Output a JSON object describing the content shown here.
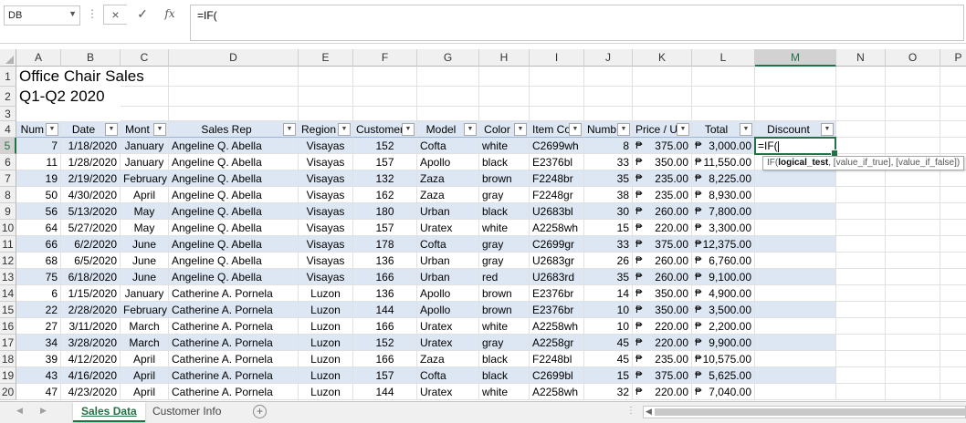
{
  "formula_bar": {
    "name_box": "DB",
    "formula": "=IF("
  },
  "icons": {
    "cancel": "×",
    "enter": "✓",
    "fx": "fx"
  },
  "columns": [
    "A",
    "B",
    "C",
    "D",
    "E",
    "F",
    "G",
    "H",
    "I",
    "J",
    "K",
    "L",
    "M",
    "N",
    "O",
    "P"
  ],
  "selected_column": "M",
  "rows": [
    "1",
    "2",
    "3",
    "4",
    "5",
    "6",
    "7",
    "8",
    "9",
    "10",
    "11",
    "12",
    "13",
    "14",
    "15",
    "16",
    "17",
    "18",
    "19",
    "20"
  ],
  "selected_row": "5",
  "sheet_title": "Office Chair Sales",
  "sheet_subtitle": "Q1-Q2 2020",
  "table_headers": [
    "Num",
    "Date",
    "Mont",
    "Sales Rep",
    "Region",
    "Customer",
    "Model",
    "Color",
    "Item Co",
    "Numb",
    "Price / Un",
    "Total",
    "Discount"
  ],
  "currency_symbol": "₱",
  "table_rows": [
    [
      "7",
      "1/18/2020",
      "January",
      "Angeline Q. Abella",
      "Visayas",
      "152",
      "Cofta",
      "white",
      "C2699wh",
      "8",
      "375.00",
      "3,000.00"
    ],
    [
      "11",
      "1/28/2020",
      "January",
      "Angeline Q. Abella",
      "Visayas",
      "157",
      "Apollo",
      "black",
      "E2376bl",
      "33",
      "350.00",
      "11,550.00"
    ],
    [
      "19",
      "2/19/2020",
      "February",
      "Angeline Q. Abella",
      "Visayas",
      "132",
      "Zaza",
      "brown",
      "F2248br",
      "35",
      "235.00",
      "8,225.00"
    ],
    [
      "50",
      "4/30/2020",
      "April",
      "Angeline Q. Abella",
      "Visayas",
      "162",
      "Zaza",
      "gray",
      "F2248gr",
      "38",
      "235.00",
      "8,930.00"
    ],
    [
      "56",
      "5/13/2020",
      "May",
      "Angeline Q. Abella",
      "Visayas",
      "180",
      "Urban",
      "black",
      "U2683bl",
      "30",
      "260.00",
      "7,800.00"
    ],
    [
      "64",
      "5/27/2020",
      "May",
      "Angeline Q. Abella",
      "Visayas",
      "157",
      "Uratex",
      "white",
      "A2258wh",
      "15",
      "220.00",
      "3,300.00"
    ],
    [
      "66",
      "6/2/2020",
      "June",
      "Angeline Q. Abella",
      "Visayas",
      "178",
      "Cofta",
      "gray",
      "C2699gr",
      "33",
      "375.00",
      "12,375.00"
    ],
    [
      "68",
      "6/5/2020",
      "June",
      "Angeline Q. Abella",
      "Visayas",
      "136",
      "Urban",
      "gray",
      "U2683gr",
      "26",
      "260.00",
      "6,760.00"
    ],
    [
      "75",
      "6/18/2020",
      "June",
      "Angeline Q. Abella",
      "Visayas",
      "166",
      "Urban",
      "red",
      "U2683rd",
      "35",
      "260.00",
      "9,100.00"
    ],
    [
      "6",
      "1/15/2020",
      "January",
      "Catherine A. Pornela",
      "Luzon",
      "136",
      "Apollo",
      "brown",
      "E2376br",
      "14",
      "350.00",
      "4,900.00"
    ],
    [
      "22",
      "2/28/2020",
      "February",
      "Catherine A. Pornela",
      "Luzon",
      "144",
      "Apollo",
      "brown",
      "E2376br",
      "10",
      "350.00",
      "3,500.00"
    ],
    [
      "27",
      "3/11/2020",
      "March",
      "Catherine A. Pornela",
      "Luzon",
      "166",
      "Uratex",
      "white",
      "A2258wh",
      "10",
      "220.00",
      "2,200.00"
    ],
    [
      "34",
      "3/28/2020",
      "March",
      "Catherine A. Pornela",
      "Luzon",
      "152",
      "Uratex",
      "gray",
      "A2258gr",
      "45",
      "220.00",
      "9,900.00"
    ],
    [
      "39",
      "4/12/2020",
      "April",
      "Catherine A. Pornela",
      "Luzon",
      "166",
      "Zaza",
      "black",
      "F2248bl",
      "45",
      "235.00",
      "10,575.00"
    ],
    [
      "43",
      "4/16/2020",
      "April",
      "Catherine A. Pornela",
      "Luzon",
      "157",
      "Cofta",
      "black",
      "C2699bl",
      "15",
      "375.00",
      "5,625.00"
    ],
    [
      "47",
      "4/23/2020",
      "April",
      "Catherine A. Pornela",
      "Luzon",
      "144",
      "Uratex",
      "white",
      "A2258wh",
      "32",
      "220.00",
      "7,040.00"
    ]
  ],
  "active_cell_value": "=IF(",
  "tooltip": {
    "fn": "IF(",
    "arg1": "logical_test",
    "rest": ", [value_if_true], [value_if_false])"
  },
  "sheet_tabs": [
    "Sales Data",
    "Customer Info"
  ],
  "active_sheet": "Sales Data"
}
